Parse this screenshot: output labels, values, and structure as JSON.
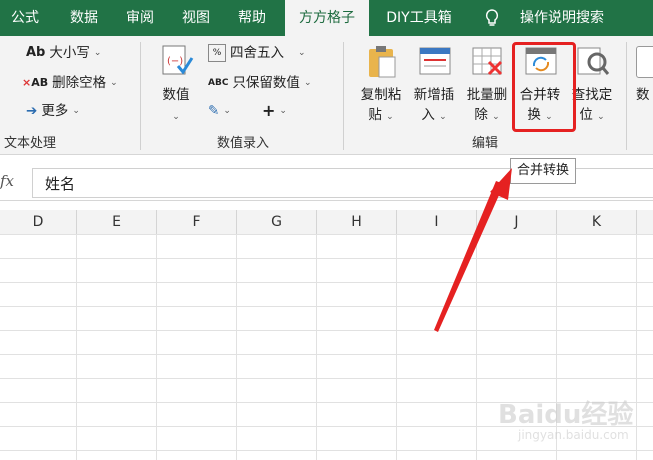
{
  "tabs": [
    "公式",
    "数据",
    "审阅",
    "视图",
    "帮助",
    "方方格子",
    "DIY工具箱",
    "操作说明搜索"
  ],
  "active_tab": "方方格子",
  "groups": {
    "text": {
      "label": "文本处理",
      "items": [
        "大小写",
        "删除空格",
        "更多"
      ]
    },
    "numeric": {
      "label": "数值录入",
      "big_button": [
        "数值"
      ],
      "items": [
        "四舍五入",
        "只保留数值"
      ]
    },
    "edit": {
      "label": "编辑",
      "buttons": [
        {
          "l1": "复制粘",
          "l2": "贴"
        },
        {
          "l1": "新增插",
          "l2": "入"
        },
        {
          "l1": "批量删",
          "l2": "除"
        },
        {
          "l1": "合并转",
          "l2": "换"
        },
        {
          "l1": "查找定",
          "l2": "位"
        }
      ]
    },
    "partial_button": "数"
  },
  "tooltip": "合并转换",
  "formula_bar": {
    "fx": "fx",
    "value": "姓名"
  },
  "columns": [
    "D",
    "E",
    "F",
    "G",
    "H",
    "I",
    "J",
    "K"
  ],
  "highlight_color": "#e52121",
  "watermark": {
    "brand": "Baidu经验",
    "sub": "jingyan.baidu.com"
  }
}
